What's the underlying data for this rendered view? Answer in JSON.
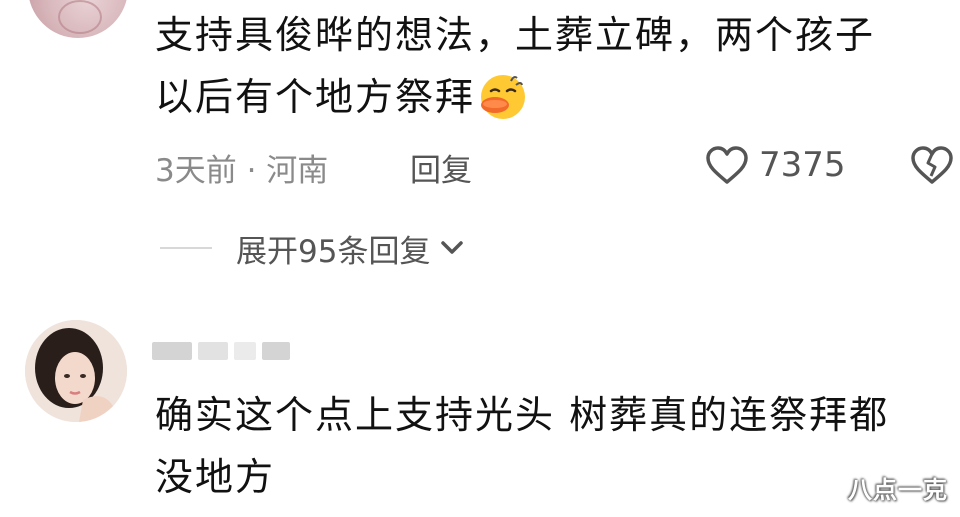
{
  "comments": [
    {
      "text_line1": "支持具俊晔的想法，土葬立碑，两个孩子",
      "text_line2": "以后有个地方祭拜",
      "emoji": "laughing-duck-emoji",
      "time_location": "3天前 · 河南",
      "reply_label": "回复",
      "like_count": "7375",
      "expand_label": "展开95条回复"
    },
    {
      "text_line1": "确实这个点上支持光头 树葬真的连祭拜都",
      "text_line2": "没地方"
    }
  ],
  "icons": {
    "like": "heart-outline-icon",
    "dislike": "broken-heart-icon",
    "expand": "chevron-down-icon"
  },
  "watermark": "八点一克",
  "colors": {
    "text": "#111111",
    "meta": "#8a8a8a",
    "action": "#555555",
    "emoji_yellow": "#ffc933",
    "emoji_orange": "#f26a2a"
  }
}
